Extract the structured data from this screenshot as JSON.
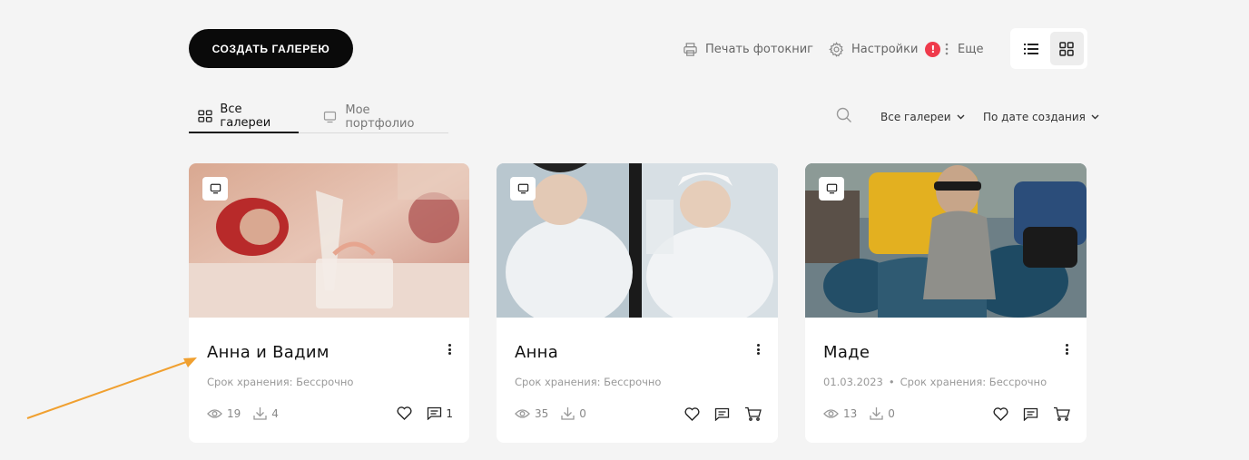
{
  "header": {
    "create_button": "СОЗДАТЬ ГАЛЕРЕЮ",
    "print_label": "Печать фотокниг",
    "settings_label": "Настройки",
    "settings_badge": "!",
    "more_label": "Еще"
  },
  "tabs": [
    {
      "label": "Все галереи",
      "active": true
    },
    {
      "label": "Мое портфолио",
      "active": false
    }
  ],
  "filters": {
    "galleries": "Все галереи",
    "sort": "По дате создания"
  },
  "cards": [
    {
      "title": "Анна и Вадим",
      "date": "",
      "storage": "Срок хранения: Бессрочно",
      "views": "19",
      "downloads": "4",
      "comments": "1"
    },
    {
      "title": "Анна",
      "date": "",
      "storage": "Срок хранения: Бессрочно",
      "views": "35",
      "downloads": "0",
      "comments": ""
    },
    {
      "title": "Маде",
      "date": "01.03.2023",
      "storage": "Срок хранения: Бессрочно",
      "views": "13",
      "downloads": "0",
      "comments": ""
    }
  ],
  "colors": {
    "accent": "#ef3a4b",
    "annotation_arrow": "#f0a030",
    "button": "#0a0a0a"
  }
}
